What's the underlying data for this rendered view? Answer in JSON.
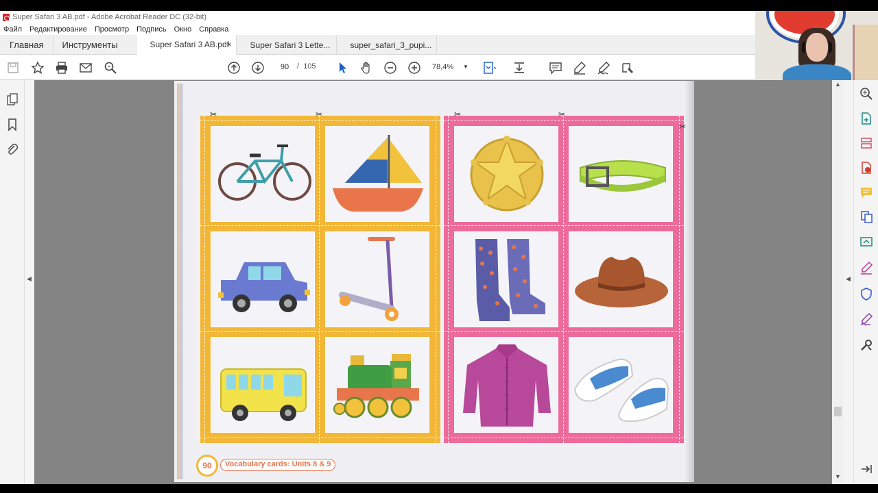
{
  "window": {
    "title": "Super Safari 3 AB.pdf - Adobe Acrobat Reader DC (32-bit)"
  },
  "menu": {
    "items": [
      "Файл",
      "Редактирование",
      "Просмотр",
      "Подпись",
      "Окно",
      "Справка"
    ]
  },
  "tabs": {
    "home": "Главная",
    "tools": "Инструменты",
    "docs": [
      {
        "label": "Super Safari 3 AB.pdf",
        "active": true,
        "close": "×"
      },
      {
        "label": "Super Safari 3 Lette...",
        "active": false
      },
      {
        "label": "super_safari_3_pupi...",
        "active": false
      }
    ]
  },
  "toolbar": {
    "current_page": "90",
    "page_separator": "/",
    "total_pages": "105",
    "zoom": "78,4%"
  },
  "document": {
    "page_number": "90",
    "footer_label": "Vocabulary cards: Units 8 & 9",
    "yellow_cards": [
      "bicycle",
      "sailboat",
      "car",
      "scooter",
      "bus",
      "train"
    ],
    "pink_cards": [
      "sheriff-badge",
      "belt",
      "boots",
      "cowboy-hat",
      "shirt",
      "shoes"
    ],
    "colors": {
      "yellow_panel": "#f2b737",
      "pink_panel": "#ec6b9a"
    }
  }
}
